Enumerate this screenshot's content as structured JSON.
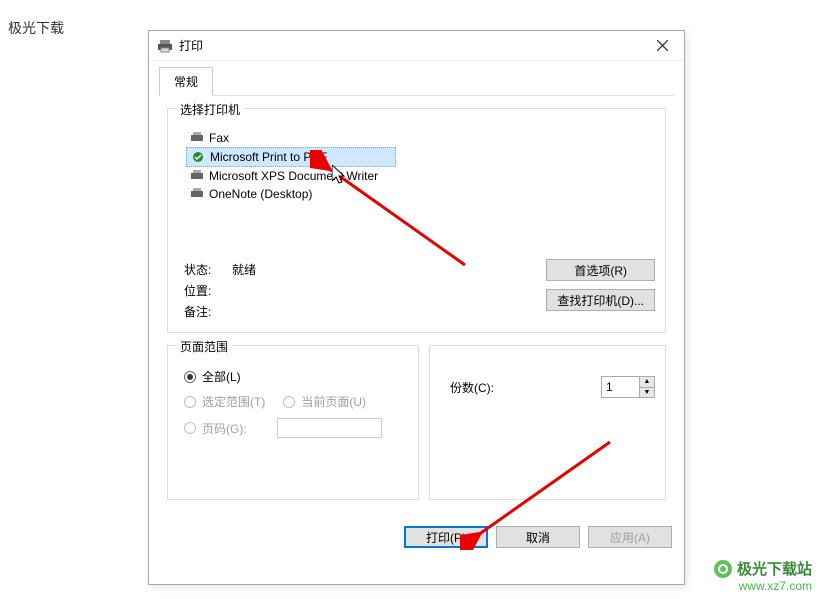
{
  "watermark_top": "极光下载",
  "dialog": {
    "title": "打印",
    "tab_general": "常规",
    "group_select_printer": "选择打印机",
    "printers": [
      {
        "name": "Fax"
      },
      {
        "name": "Microsoft Print to PDF"
      },
      {
        "name": "Microsoft XPS Document Writer"
      },
      {
        "name": "OneNote (Desktop)"
      }
    ],
    "status_label": "状态:",
    "status_value": "就绪",
    "location_label": "位置:",
    "comment_label": "备注:",
    "btn_preferences": "首选项(R)",
    "btn_find_printer": "查找打印机(D)...",
    "group_page_range": "页面范围",
    "radio_all": "全部(L)",
    "radio_selection": "选定范围(T)",
    "radio_current": "当前页面(U)",
    "radio_pages": "页码(G):",
    "copies_label": "份数(C):",
    "copies_value": "1",
    "btn_print": "打印(P)",
    "btn_cancel": "取消",
    "btn_apply": "应用(A)"
  },
  "watermark_bottom": {
    "name": "极光下载站",
    "url": "www.xz7.com"
  }
}
